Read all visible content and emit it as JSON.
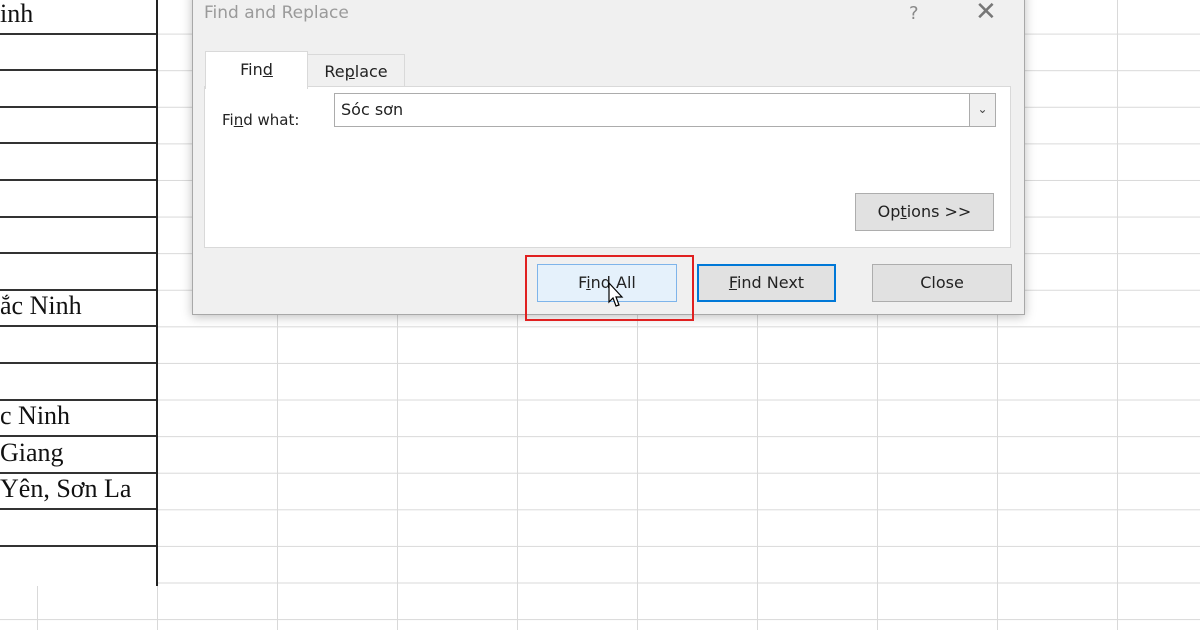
{
  "sheet": {
    "column_a": [
      {
        "row": 0,
        "text": "inh"
      },
      {
        "row": 1,
        "text": ""
      },
      {
        "row": 2,
        "text": ""
      },
      {
        "row": 3,
        "text": ""
      },
      {
        "row": 4,
        "text": ""
      },
      {
        "row": 5,
        "text": ""
      },
      {
        "row": 6,
        "text": ""
      },
      {
        "row": 7,
        "text": ""
      },
      {
        "row": 8,
        "text": "ắc Ninh"
      },
      {
        "row": 9,
        "text": ""
      },
      {
        "row": 10,
        "text": ""
      },
      {
        "row": 11,
        "text": "c Ninh"
      },
      {
        "row": 12,
        "text": "Giang"
      },
      {
        "row": 13,
        "text": "Yên, Sơn La"
      },
      {
        "row": 14,
        "text": ""
      }
    ]
  },
  "dialog": {
    "title": "Find and Replace",
    "help": "?",
    "close_glyph": "✕",
    "tabs": [
      {
        "pre": "Fin",
        "u": "d",
        "post": ""
      },
      {
        "pre": "Re",
        "u": "p",
        "post": "lace"
      }
    ],
    "find_what": {
      "pre": "Fi",
      "u": "n",
      "post": "d what:"
    },
    "find_value": "Sóc sơn",
    "dropdown_glyph": "⌄",
    "options": {
      "pre": "Op",
      "u": "t",
      "post": "ions >>"
    },
    "find_all": {
      "pre": "F",
      "u": "i",
      "post": "nd All"
    },
    "find_next": {
      "pre": "",
      "u": "F",
      "post": "ind Next"
    },
    "close_label": "Close",
    "accent": "#0078d7",
    "highlight": "#e02020"
  }
}
